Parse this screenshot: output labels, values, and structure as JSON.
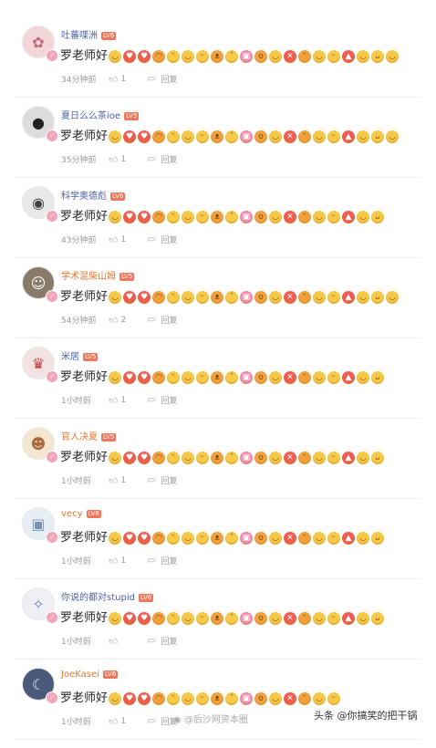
{
  "comments": [
    {
      "user": "吐蕃喋洲",
      "user_color": "blue",
      "level": "LV6",
      "avatar_icon": "anime-avatar",
      "text": "罗老师好",
      "time": "34分钟前",
      "likes": "1",
      "reply": "回复",
      "emoji_count": 20
    },
    {
      "user": "夏日么么茶ioe",
      "user_color": "blue",
      "level": "LV5",
      "avatar_icon": "panda-avatar",
      "text": "罗老师好",
      "time": "35分钟前",
      "likes": "1",
      "reply": "回复",
      "emoji_count": 20
    },
    {
      "user": "科学奥德彪",
      "user_color": "blue",
      "level": "LV6",
      "avatar_icon": "glasses-avatar",
      "text": "罗老师好",
      "time": "43分钟前",
      "likes": "1",
      "reply": "回复",
      "emoji_count": 19
    },
    {
      "user": "学术混柴山姆",
      "user_color": "orange",
      "level": "LV5",
      "avatar_icon": "man-avatar",
      "text": "罗老师好",
      "time": "54分钟前",
      "likes": "2",
      "reply": "回复",
      "emoji_count": 20
    },
    {
      "user": "米居",
      "user_color": "blue",
      "level": "LV5",
      "avatar_icon": "costume-avatar",
      "text": "罗老师好",
      "time": "1小时前",
      "likes": "1",
      "reply": "回复",
      "emoji_count": 19
    },
    {
      "user": "官人决夏",
      "user_color": "orange",
      "level": "LV5",
      "avatar_icon": "doll-avatar",
      "text": "罗老师好",
      "time": "1小时前",
      "likes": "1",
      "reply": "回复",
      "emoji_count": 19
    },
    {
      "user": "vecy",
      "user_color": "orange",
      "level": "LV6",
      "avatar_icon": "tv-avatar",
      "text": "罗老师好",
      "time": "1小时前",
      "likes": "1",
      "reply": "回复",
      "emoji_count": 19
    },
    {
      "user": "你说的都对stupid",
      "user_color": "blue",
      "level": "LV6",
      "avatar_icon": "anime-girl-avatar",
      "text": "罗老师好",
      "time": "1小时前",
      "likes": "",
      "reply": "回复",
      "emoji_count": 19
    },
    {
      "user": "JoeKasei",
      "user_color": "orange",
      "level": "LV6",
      "avatar_icon": "night-avatar",
      "text": "罗老师好",
      "time": "1小时前",
      "likes": "1",
      "reply": "回复",
      "emoji_count": 16
    }
  ],
  "watermarks": {
    "weibo": "@后沙网资本圈",
    "toutiao": "头条 @你搞笑的把干锅"
  },
  "colors": {
    "name_blue": "#4a5ea8",
    "name_orange": "#e8772e",
    "level_badge": "#f0765b",
    "emoji": "#f7c948"
  }
}
